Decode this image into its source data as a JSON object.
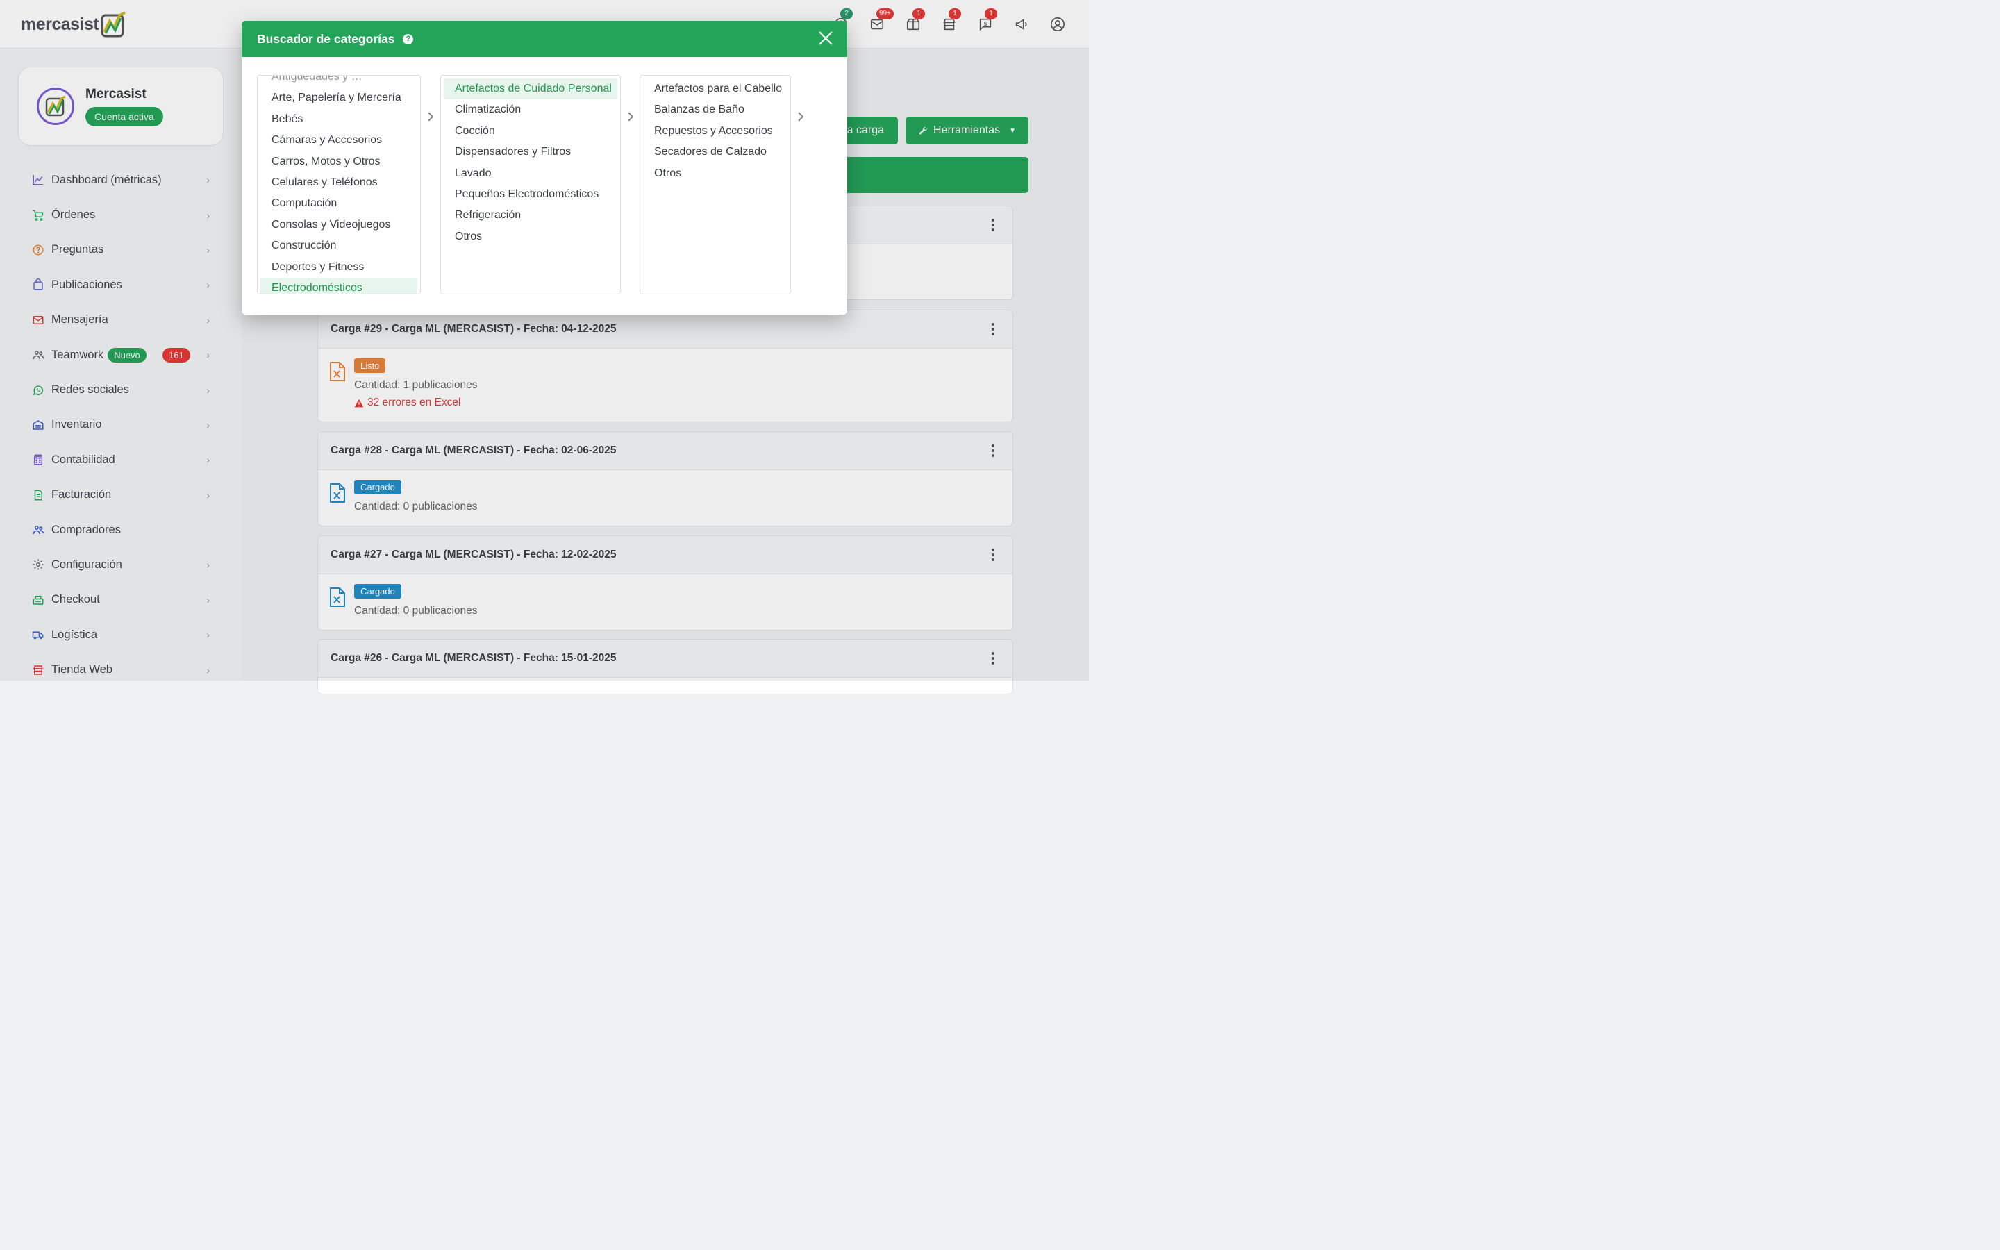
{
  "topbar": {
    "logo_text": "mercasist",
    "icons": [
      {
        "name": "help-icon",
        "badge": "2",
        "badge_color": "#2a9d6b"
      },
      {
        "name": "mail-icon",
        "badge": "99+",
        "badge_color": "#e53935"
      },
      {
        "name": "box-icon",
        "badge": "1",
        "badge_color": "#e53935"
      },
      {
        "name": "store-icon",
        "badge": "1",
        "badge_color": "#e53935"
      },
      {
        "name": "dollar-chat-icon",
        "badge": "1",
        "badge_color": "#e53935"
      },
      {
        "name": "megaphone-icon",
        "badge": "",
        "badge_color": ""
      },
      {
        "name": "user-circle-icon",
        "badge": "",
        "badge_color": ""
      }
    ]
  },
  "profile": {
    "name": "Mercasist",
    "status": "Cuenta activa"
  },
  "sidebar": {
    "items": [
      {
        "label": "Dashboard (métricas)",
        "icon": "chart-line-icon"
      },
      {
        "label": "Órdenes",
        "icon": "cart-icon"
      },
      {
        "label": "Preguntas",
        "icon": "question-circle-icon"
      },
      {
        "label": "Publicaciones",
        "icon": "bag-icon"
      },
      {
        "label": "Mensajería",
        "icon": "envelope-icon"
      },
      {
        "label": "Teamwork",
        "icon": "users-icon",
        "tag": "Nuevo",
        "count": "161"
      },
      {
        "label": "Redes sociales",
        "icon": "whatsapp-icon"
      },
      {
        "label": "Inventario",
        "icon": "warehouse-icon"
      },
      {
        "label": "Contabilidad",
        "icon": "calculator-icon"
      },
      {
        "label": "Facturación",
        "icon": "invoice-icon"
      },
      {
        "label": "Compradores",
        "icon": "buyers-icon"
      },
      {
        "label": "Configuración",
        "icon": "gear-icon"
      },
      {
        "label": "Checkout",
        "icon": "checkout-icon"
      },
      {
        "label": "Logística",
        "icon": "truck-icon"
      },
      {
        "label": "Tienda Web",
        "icon": "shop-icon"
      }
    ]
  },
  "main": {
    "new_upload_label": "a carga",
    "tools_label": "Herramientas",
    "cards": [
      {
        "title": "Carga #29 - Carga ML (MERCASIST) - Fecha: 04-12-2025",
        "status": "Listo",
        "status_color": "#e8833a",
        "quantity": "Cantidad: 1 publicaciones",
        "errors": "32 errores en Excel"
      },
      {
        "title": "Carga #28 - Carga ML (MERCASIST) - Fecha: 02-06-2025",
        "status": "Cargado",
        "status_color": "#1f8ec9",
        "quantity": "Cantidad: 0 publicaciones"
      },
      {
        "title": "Carga #27 - Carga ML (MERCASIST) - Fecha: 12-02-2025",
        "status": "Cargado",
        "status_color": "#1f8ec9",
        "quantity": "Cantidad: 0 publicaciones"
      },
      {
        "title": "Carga #26 - Carga ML (MERCASIST) - Fecha: 15-01-2025"
      }
    ]
  },
  "modal": {
    "title": "Buscador de categorías",
    "columns": [
      {
        "items": [
          "Arte, Papelería y Mercería",
          "Bebés",
          "Cámaras y Accesorios",
          "Carros, Motos y Otros",
          "Celulares y Teléfonos",
          "Computación",
          "Consolas y Videojuegos",
          "Construcción",
          "Deportes y Fitness",
          "Electrodomésticos"
        ],
        "selected": "Electrodomésticos"
      },
      {
        "items": [
          "Artefactos de Cuidado Personal",
          "Climatización",
          "Cocción",
          "Dispensadores y Filtros",
          "Lavado",
          "Pequeños Electrodomésticos",
          "Refrigeración",
          "Otros"
        ],
        "selected": "Artefactos de Cuidado Personal"
      },
      {
        "items": [
          "Artefactos para el Cabello",
          "Balanzas de Baño",
          "Repuestos y Accesorios",
          "Secadores de Calzado",
          "Otros"
        ],
        "selected": ""
      }
    ]
  },
  "colors": {
    "brand_green": "#23a55a",
    "badge_red": "#e53935",
    "status_orange": "#e8833a",
    "status_blue": "#1f8ec9",
    "selection_bg": "#e8f5ec"
  }
}
